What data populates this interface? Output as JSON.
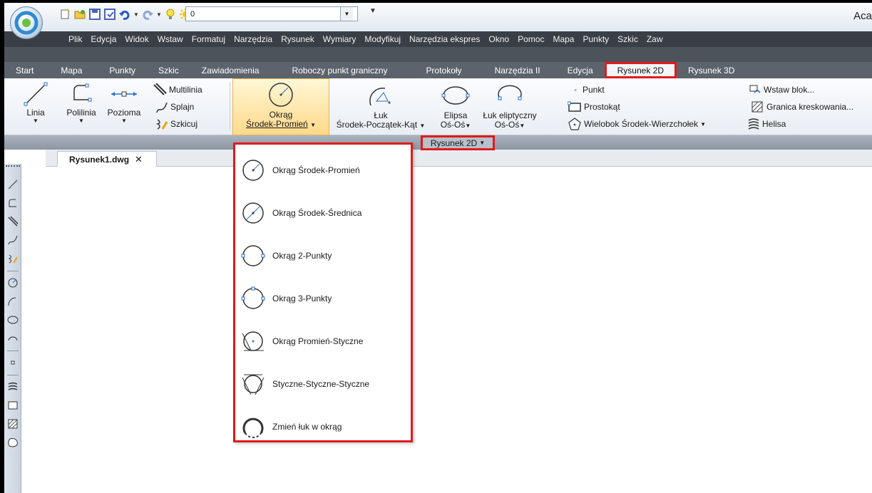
{
  "window": {
    "title": "Aca"
  },
  "qat": {
    "layer_value": "0",
    "icons": [
      "new-icon",
      "open-icon",
      "save-icon",
      "save-as-icon",
      "undo-icon",
      "redo-icon",
      "bulb-icon",
      "sun-icon",
      "freeze-icon",
      "lock-icon",
      "color-swatch-icon"
    ]
  },
  "menu": [
    "Plik",
    "Edycja",
    "Widok",
    "Wstaw",
    "Formatuj",
    "Narzędzia",
    "Rysunek",
    "Wymiary",
    "Modyfikuj",
    "Narzędzia ekspres",
    "Okno",
    "Pomoc",
    "Mapa",
    "Punkty",
    "Szkic",
    "Zaw"
  ],
  "tabs": [
    "Start",
    "Mapa",
    "Punkty",
    "Szkic",
    "Zawiadomienia",
    "Roboczy punkt graniczny",
    "Protokoły",
    "Narzędzia II",
    "Edycja",
    "Rysunek 2D",
    "Rysunek 3D"
  ],
  "active_tab": "Rysunek 2D",
  "accent_color": "#e01b1b",
  "ribbon": {
    "linia": "Linia",
    "polilinia": "Polilinia",
    "pozioma": "Pozioma",
    "multilinia": "Multilinia",
    "splajn": "Splajn",
    "szkicuj": "Szkicuj",
    "okrag_line1": "Okrąg",
    "okrag_line2": "Środek-Promień",
    "luk_line1": "Łuk",
    "luk_line2": "Środek-Początek-Kąt",
    "elipsa_line1": "Elipsa",
    "elipsa_line2": "Oś-Oś",
    "luk_elipt_line1": "Łuk eliptyczny",
    "luk_elipt_line2": "Oś-Oś",
    "punkt": "Punkt",
    "prostokat": "Prostokąt",
    "wielobok": "Wielobok Środek-Wierzchołek",
    "wstaw_blok": "Wstaw blok...",
    "granica": "Granica kreskowania...",
    "helisa": "Helisa",
    "panel_title": "Rysunek 2D"
  },
  "document_tab": {
    "name": "Rysunek1.dwg",
    "close": "✕"
  },
  "dropdown_items": [
    "Okrąg Środek-Promień",
    "Okrąg Środek-Średnica",
    "Okrąg 2-Punkty",
    "Okrąg 3-Punkty",
    "Okrąg Promień-Styczne",
    "Styczne-Styczne-Styczne",
    "Zmień łuk w okrąg"
  ]
}
